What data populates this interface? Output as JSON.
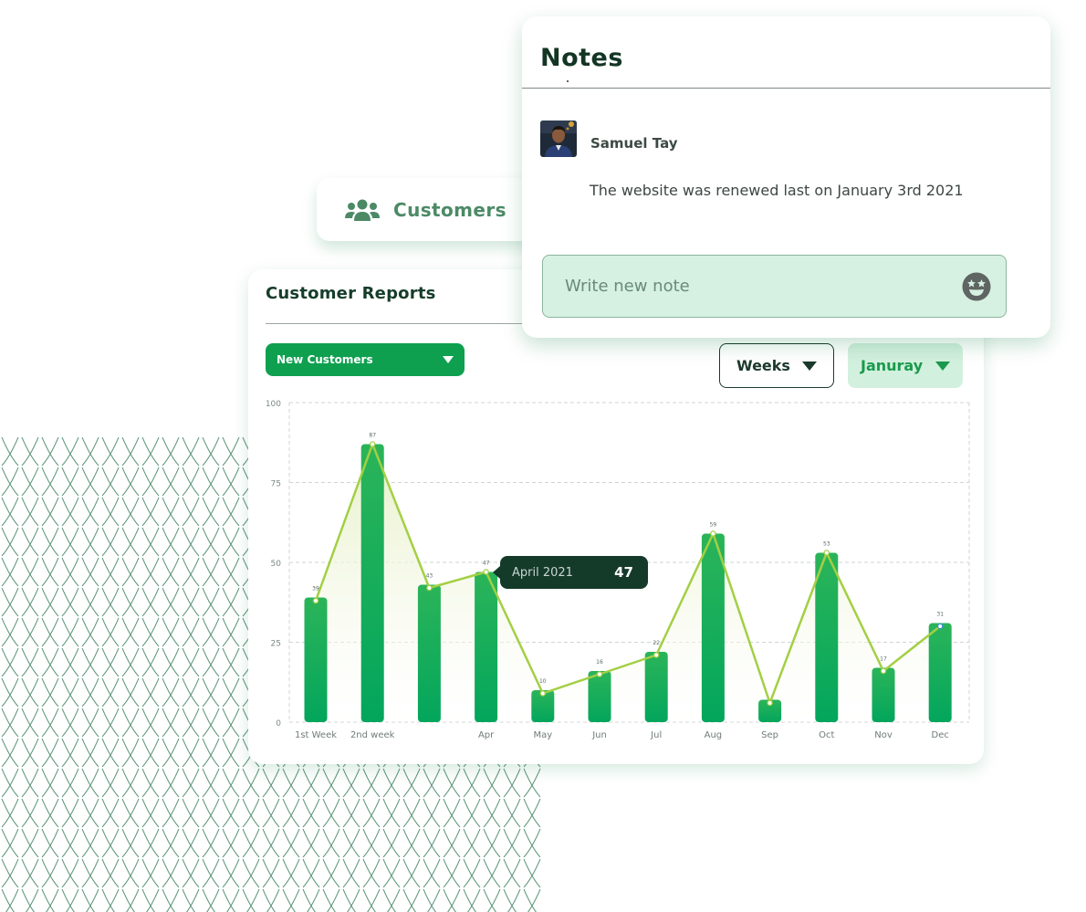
{
  "notes": {
    "title": "Notes",
    "author": "Samuel Tay",
    "text": "The website was renewed last on January 3rd 2021",
    "input_placeholder": "Write new note"
  },
  "customers_tab": {
    "label": "Customers"
  },
  "report": {
    "title": "Customer Reports",
    "metric_selected": "New Customers",
    "period_selected": "Weeks",
    "month_selected": "Januray"
  },
  "tooltip": {
    "label": "April 2021",
    "value": "47"
  },
  "colors": {
    "bar": "#10a852",
    "line": "#a3cf44",
    "dark": "#143a2a",
    "accent_light": "#d2f0de"
  },
  "chart_data": {
    "type": "bar",
    "categories": [
      "1st Week",
      "2nd week",
      "",
      "Apr",
      "May",
      "Jun",
      "Jul",
      "Aug",
      "Sep",
      "Oct",
      "Nov",
      "Dec"
    ],
    "values": [
      39,
      87,
      43,
      47,
      10,
      16,
      22,
      59,
      7,
      53,
      17,
      31
    ],
    "line_values": [
      38,
      87,
      42,
      47,
      9,
      15,
      21,
      59,
      6,
      53,
      16,
      30
    ],
    "value_labels": [
      "39",
      "87",
      "43",
      "47",
      "10",
      "16",
      "22",
      "59",
      "",
      "53",
      "17",
      "31"
    ],
    "yticks": [
      0,
      25,
      50,
      75,
      100
    ],
    "ylim": [
      0,
      100
    ],
    "grid": true
  }
}
